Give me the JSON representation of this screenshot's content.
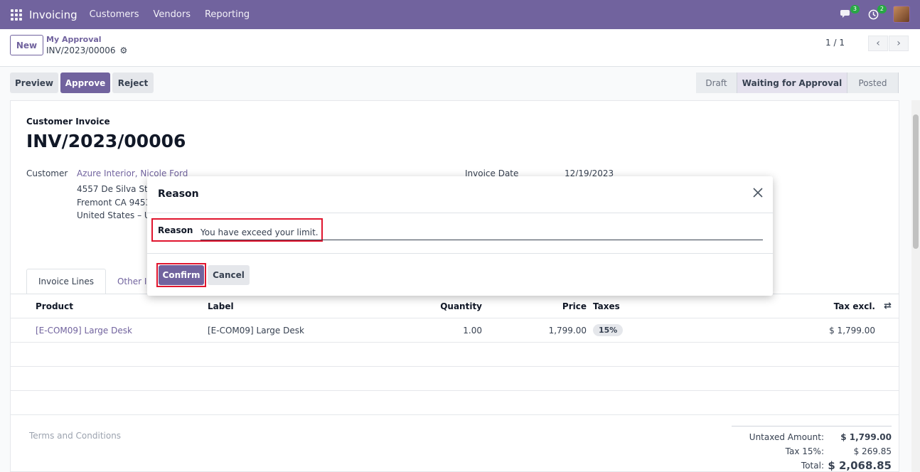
{
  "navbar": {
    "brand": "Invoicing",
    "menu": [
      "Customers",
      "Vendors",
      "Reporting"
    ],
    "messages_count": "3",
    "activities_count": "2",
    "accent_color": "#71639e"
  },
  "control_panel": {
    "new_label": "New",
    "breadcrumb_parent": "My Approval",
    "breadcrumb_current": "INV/2023/00006",
    "pager": "1 / 1"
  },
  "actions": {
    "preview": "Preview",
    "approve": "Approve",
    "reject": "Reject"
  },
  "statusbar": [
    "Draft",
    "Waiting for Approval",
    "Posted"
  ],
  "invoice": {
    "type_label": "Customer Invoice",
    "name": "INV/2023/00006",
    "customer_label": "Customer",
    "customer": "Azure Interior, Nicole Ford",
    "address": [
      "4557 De Silva St",
      "Fremont CA 9453",
      "United States – U"
    ],
    "date_label": "Invoice Date",
    "date": "12/19/2023"
  },
  "tabs": [
    "Invoice Lines",
    "Other Inf"
  ],
  "lines": {
    "headers": {
      "product": "Product",
      "label": "Label",
      "quantity": "Quantity",
      "price": "Price",
      "taxes": "Taxes",
      "tax_excl": "Tax excl."
    },
    "rows": [
      {
        "product": "[E-COM09] Large Desk",
        "label": "[E-COM09] Large Desk",
        "quantity": "1.00",
        "price": "1,799.00",
        "tax": "15%",
        "tax_excl": "$ 1,799.00"
      }
    ]
  },
  "terms_placeholder": "Terms and Conditions",
  "totals": {
    "untaxed_label": "Untaxed Amount:",
    "untaxed": "$ 1,799.00",
    "tax_label": "Tax 15%:",
    "tax": "$ 269.85",
    "total_label": "Total:",
    "total": "$ 2,068.85"
  },
  "dialog": {
    "title": "Reason",
    "field_label": "Reason",
    "field_value": "You have exceed your limit.",
    "confirm": "Confirm",
    "cancel": "Cancel",
    "highlight_color": "#e0152e"
  }
}
